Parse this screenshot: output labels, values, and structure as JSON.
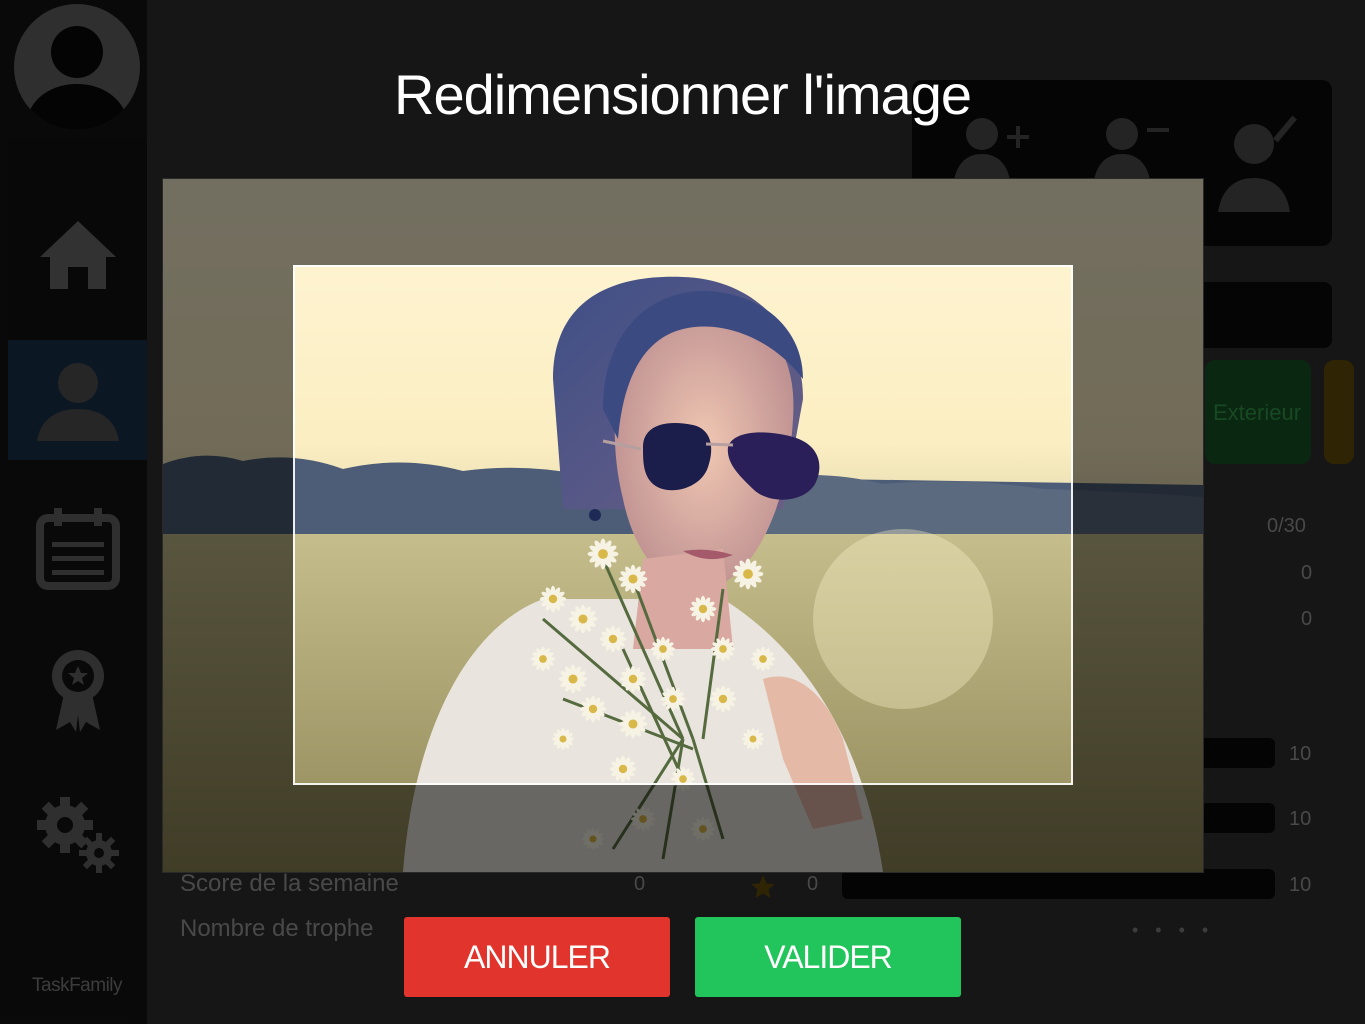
{
  "app": {
    "brand": "TaskFamily"
  },
  "sidebar": {
    "items": [
      {
        "name": "home",
        "icon": "home-icon"
      },
      {
        "name": "profile",
        "icon": "user-icon",
        "active": true
      },
      {
        "name": "calendar",
        "icon": "calendar-icon"
      },
      {
        "name": "awards",
        "icon": "award-ribbon-icon"
      },
      {
        "name": "settings",
        "icon": "gear-icon"
      }
    ]
  },
  "background": {
    "user_actions": [
      "user-add-icon",
      "user-remove-icon",
      "user-edit-icon"
    ],
    "category_label": "Exterieur",
    "stats": [
      {
        "value": "0/30"
      },
      {
        "value": "0"
      },
      {
        "value": "0"
      }
    ],
    "score_label": "Score de la semaine",
    "score_value": "0",
    "trophies_label": "Nombre de trophe",
    "star_value": "0",
    "bar_values": [
      "10",
      "10",
      "10"
    ],
    "dots": "• • • •"
  },
  "modal": {
    "title": "Redimensionner l'image",
    "cancel_label": "ANNULER",
    "ok_label": "VALIDER"
  },
  "colors": {
    "cancel": "#e1342c",
    "ok": "#22c55b",
    "sidebar_active": "#0f1d2c"
  }
}
